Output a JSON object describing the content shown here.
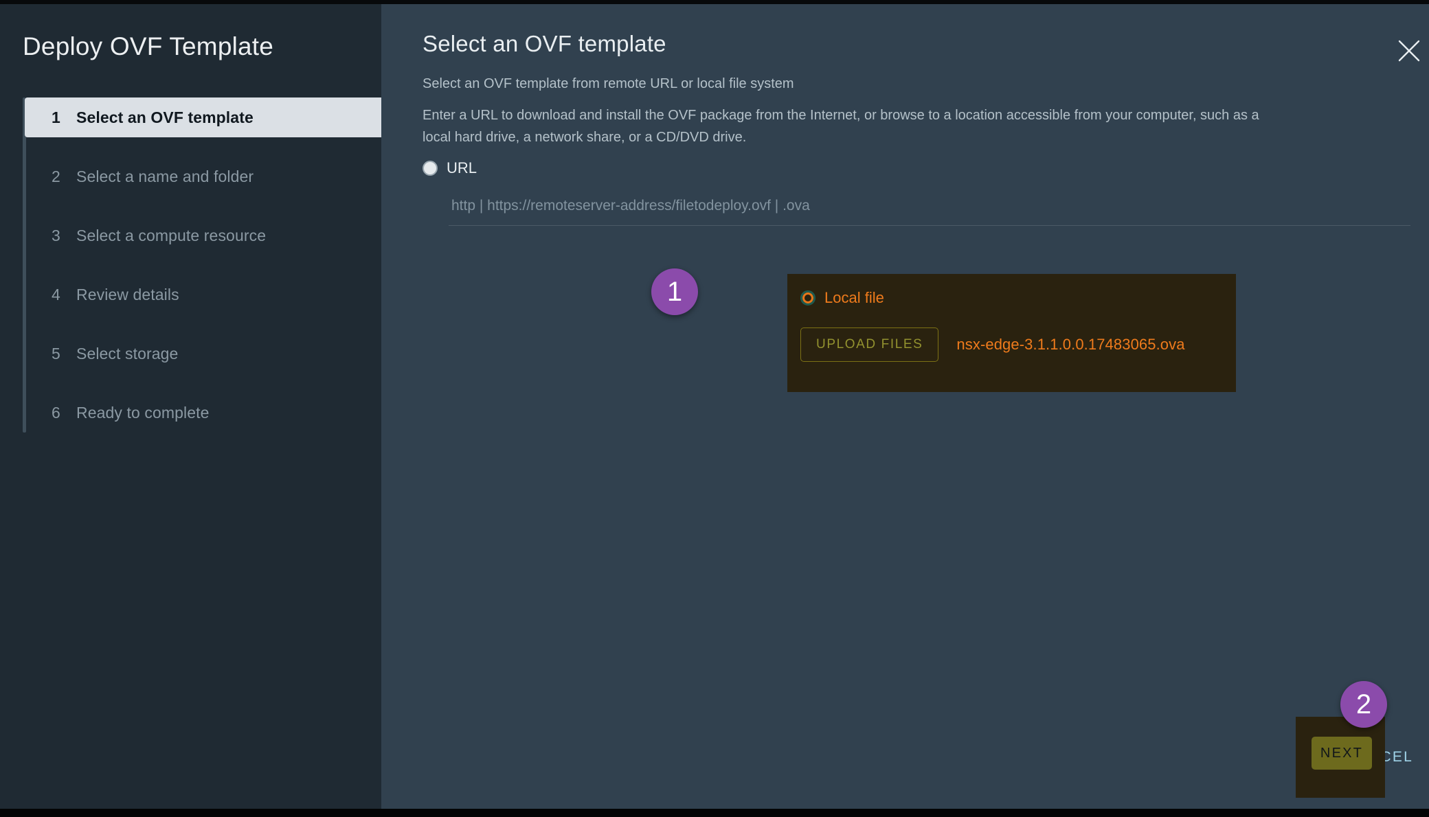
{
  "window": {
    "title": "Deploy OVF Template",
    "close_icon": "close-icon"
  },
  "sidebar": {
    "steps": [
      {
        "num": "1",
        "label": "Select an OVF template",
        "active": true
      },
      {
        "num": "2",
        "label": "Select a name and folder",
        "active": false
      },
      {
        "num": "3",
        "label": "Select a compute resource",
        "active": false
      },
      {
        "num": "4",
        "label": "Review details",
        "active": false
      },
      {
        "num": "5",
        "label": "Select storage",
        "active": false
      },
      {
        "num": "6",
        "label": "Ready to complete",
        "active": false
      }
    ]
  },
  "main": {
    "title": "Select an OVF template",
    "subtitle": "Select an OVF template from remote URL or local file system",
    "description": "Enter a URL to download and install the OVF package from the Internet, or browse to a location accessible from your computer, such as a local hard drive, a network share, or a CD/DVD drive.",
    "url_option": {
      "label": "URL",
      "selected": false,
      "input_value": "",
      "input_placeholder": "http | https://remoteserver-address/filetodeploy.ovf | .ova"
    },
    "local_file_option": {
      "label": "Local file",
      "selected": true,
      "upload_button_label": "UPLOAD FILES",
      "filename": "nsx-edge-3.1.1.0.0.17483065.ova"
    }
  },
  "footer": {
    "cancel_label": "CANCEL",
    "next_label": "NEXT"
  },
  "annotations": [
    {
      "id": "1",
      "text": "1"
    },
    {
      "id": "2",
      "text": "2"
    }
  ],
  "colors": {
    "sidebar_bg": "#1f2a33",
    "content_bg": "#31414f",
    "active_step_bg": "#dbe0e5",
    "highlight_box_bg": "#2a220f",
    "accent_orange": "#ef7b1c",
    "accent_olive": "#6d6a1d",
    "badge_purple": "#8b4bab",
    "cancel_blue": "#9fd3e8"
  }
}
